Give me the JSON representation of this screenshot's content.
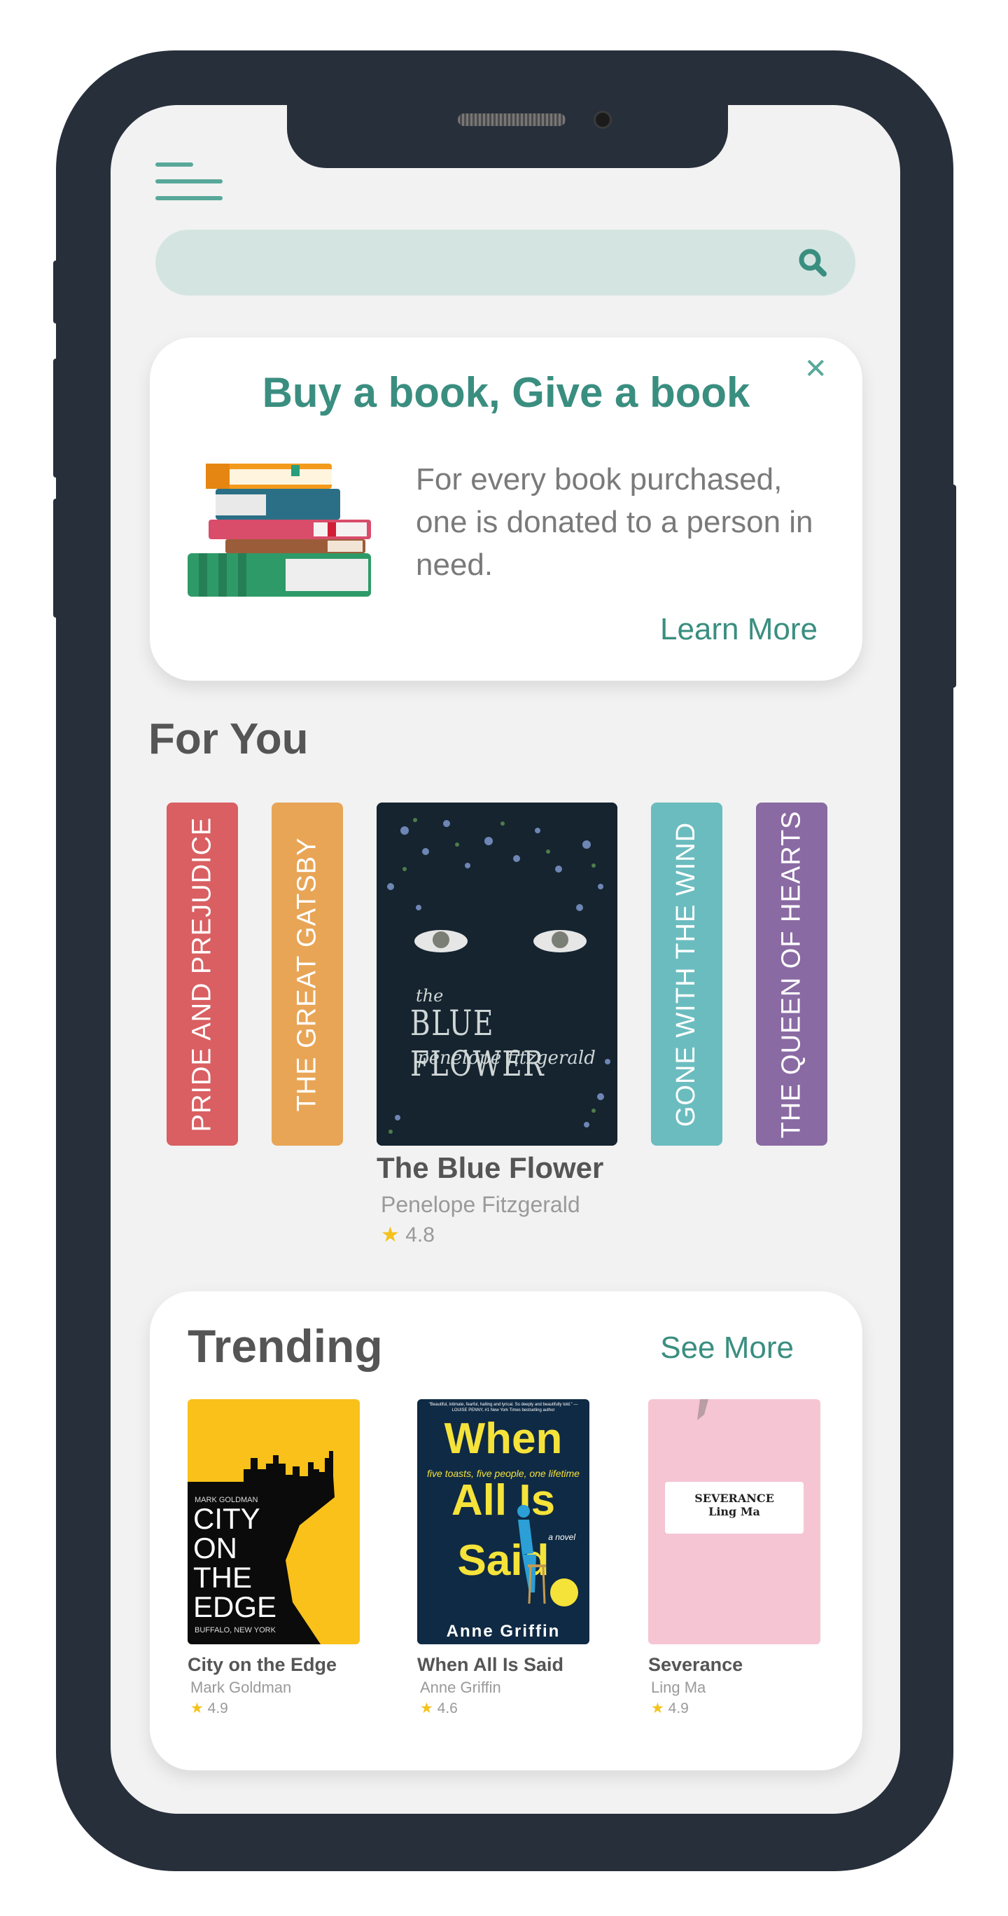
{
  "search": {
    "placeholder": ""
  },
  "promo": {
    "title": "Buy a book, Give a book",
    "text": "For every book purchased, one is donated to a person in need.",
    "link": "Learn More"
  },
  "for_you": {
    "title": "For You",
    "spines": [
      {
        "title": "PRIDE AND PREJUDICE",
        "color": "#d95f62"
      },
      {
        "title": "THE GREAT GATSBY",
        "color": "#e8a556"
      },
      {
        "title": "GONE WITH THE WIND",
        "color": "#6bbcbf"
      },
      {
        "title": "THE QUEEN OF HEARTS",
        "color": "#8a6aa3"
      }
    ],
    "featured": {
      "cover_small": "the",
      "cover_title": "BLUE FLOWER",
      "cover_author": "penelope fitzgerald",
      "title": "The Blue Flower",
      "author": "Penelope Fitzgerald",
      "rating": "4.8"
    }
  },
  "trending": {
    "title": "Trending",
    "see_more": "See More",
    "books": [
      {
        "title": "City on the Edge",
        "author": "Mark Goldman",
        "rating": "4.9",
        "cover": {
          "author": "MARK GOLDMAN",
          "line1": "CITY",
          "line2": "ON",
          "line3": "THE",
          "line4": "EDGE",
          "sub": "BUFFALO, NEW YORK"
        }
      },
      {
        "title": "When All Is Said",
        "author": "Anne Griffin",
        "rating": "4.6",
        "cover": {
          "quote": "\"Beautiful, intimate, fearful, halting and lyrical. So deeply and beautifully told.\" —LOUISE PENNY, #1 New York Times bestselling author",
          "line1": "When",
          "line2": "All Is",
          "line3": "Said",
          "tagline": "five toasts, five people, one lifetime",
          "novel": "a novel",
          "author": "Anne Griffin"
        }
      },
      {
        "title": "Severance",
        "author": "Ling Ma",
        "rating": "4.9",
        "cover": {
          "title": "SEVERANCE",
          "author": "Ling Ma"
        }
      }
    ]
  },
  "colors": {
    "accent": "#3a8e80",
    "search_bg": "#d4e5e1",
    "frame": "#272f3b",
    "star": "#f4c21b"
  }
}
